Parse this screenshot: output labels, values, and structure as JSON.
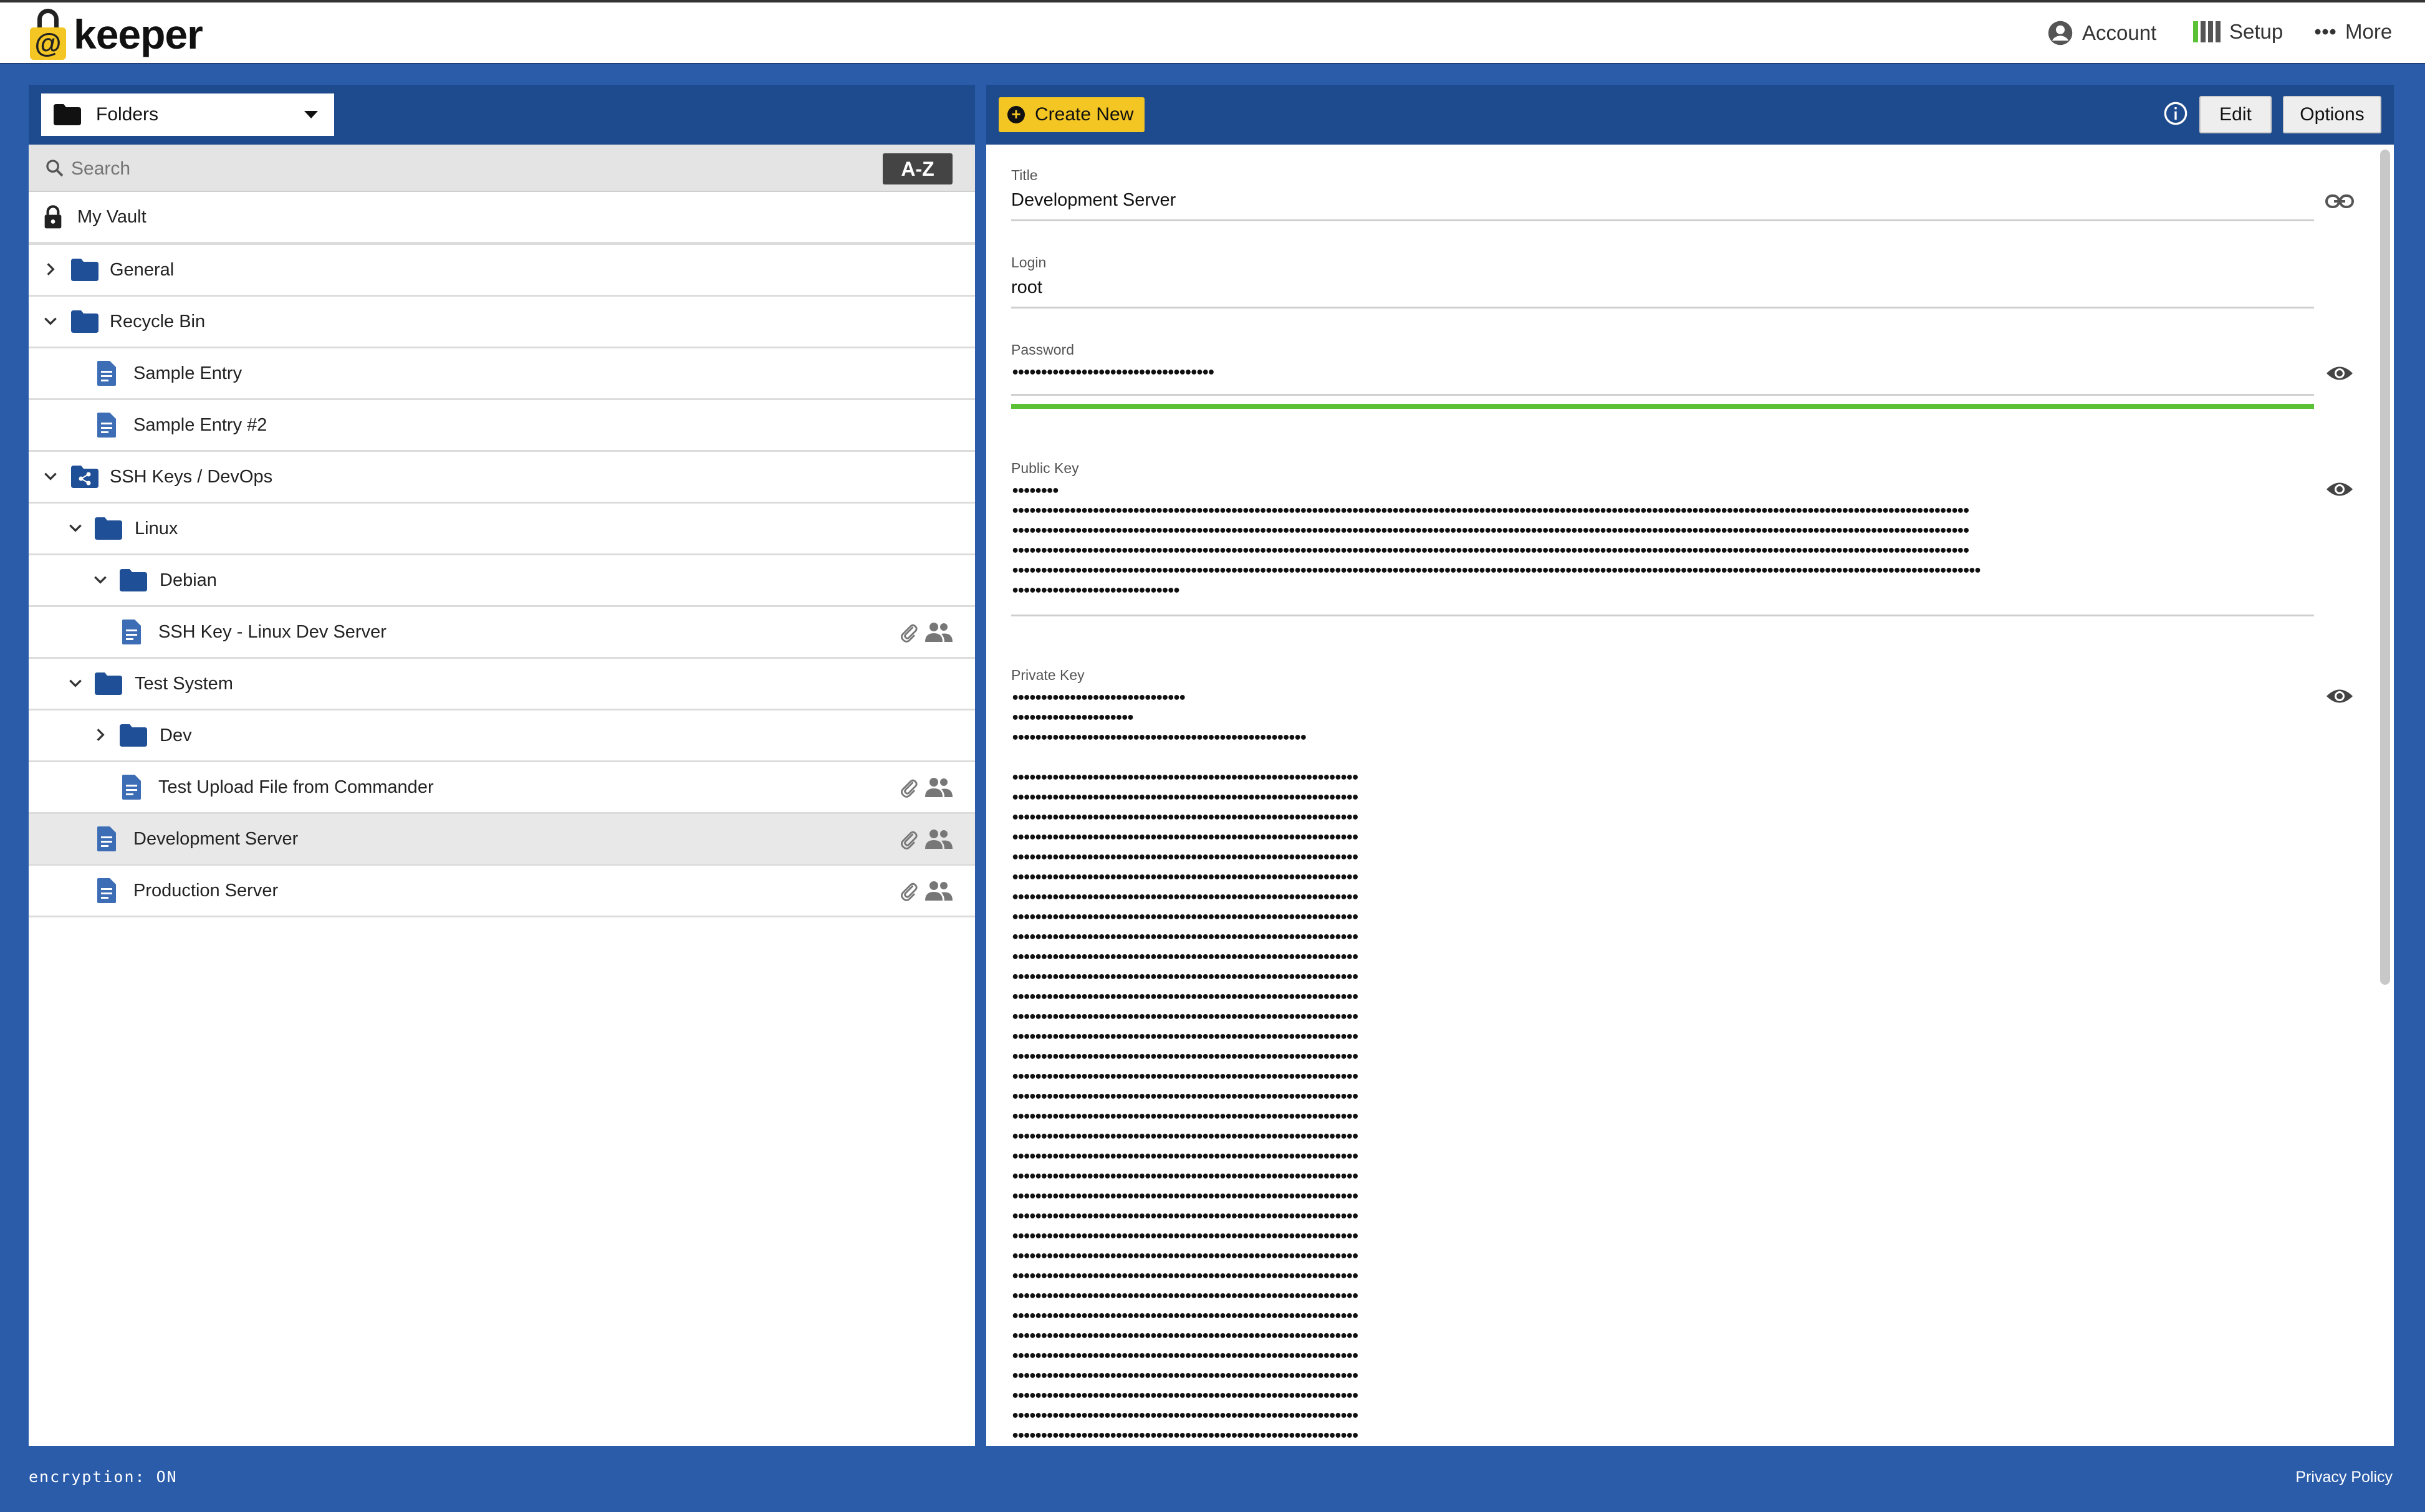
{
  "app": {
    "logo_symbol": "@",
    "logo_text": "keeper"
  },
  "topnav": {
    "account_label": "Account",
    "setup_label": "Setup",
    "more_label": "More"
  },
  "left": {
    "folders_select": "Folders",
    "search_placeholder": "Search",
    "sort_label": "A-Z",
    "tree": [
      {
        "label": "My Vault",
        "type": "vault",
        "expanded": null
      },
      {
        "label": "General",
        "type": "folder",
        "expanded": false
      },
      {
        "label": "Recycle Bin",
        "type": "folder",
        "expanded": true
      },
      {
        "label": "Sample Entry",
        "type": "record"
      },
      {
        "label": "Sample Entry #2",
        "type": "record"
      },
      {
        "label": "SSH Keys / DevOps",
        "type": "shared-folder",
        "expanded": true
      },
      {
        "label": "Linux",
        "type": "folder",
        "expanded": true
      },
      {
        "label": "Debian",
        "type": "folder",
        "expanded": true
      },
      {
        "label": "SSH Key - Linux Dev Server",
        "type": "record",
        "attachment": true,
        "shared": true
      },
      {
        "label": "Test System",
        "type": "folder",
        "expanded": true
      },
      {
        "label": "Dev",
        "type": "folder",
        "expanded": false
      },
      {
        "label": "Test Upload File from Commander",
        "type": "record",
        "attachment": true,
        "shared": true
      },
      {
        "label": "Development Server",
        "type": "record",
        "attachment": true,
        "shared": true,
        "selected": true
      },
      {
        "label": "Production Server",
        "type": "record",
        "attachment": true,
        "shared": true
      }
    ]
  },
  "right": {
    "create_new_label": "Create New",
    "edit_label": "Edit",
    "options_label": "Options",
    "fields": {
      "title_label": "Title",
      "title_value": "Development Server",
      "login_label": "Login",
      "login_value": "root",
      "password_label": "Password",
      "password_value": "•••••••••••••••••••••••••••••••••••",
      "password_strength": 1.0,
      "public_key_label": "Public Key",
      "public_key_value": "••••••••\n••••••••••••••••••••••••••••••••••••••••••••••••••••••••••••••••••••••••••••••••••••••••••••••••••••••••••••••••••••••••••••••••••••••••••••••••••••••••••••••••••••••\n••••••••••••••••••••••••••••••••••••••••••••••••••••••••••••••••••••••••••••••••••••••••••••••••••••••••••••••••••••••••••••••••••••••••••••••••••••••••••••••••••••••\n••••••••••••••••••••••••••••••••••••••••••••••••••••••••••••••••••••••••••••••••••••••••••••••••••••••••••••••••••••••••••••••••••••••••••••••••••••••••••••••••••••••\n••••••••••••••••••••••••••••••••••••••••••••••••••••••••••••••••••••••••••••••••••••••••••••••••••••••••••••••••••••••••••••••••••••••••••••••••••••••••••••••••••••••••\n•••••••••••••••••••••••••••••",
      "private_key_label": "Private Key",
      "private_key_value": "••••••••••••••••••••••••••••••\n•••••••••••••••••••••\n•••••••••••••••••••••••••••••••••••••••••••••••••••\n\n••••••••••••••••••••••••••••••••••••••••••••••••••••••••••••\n••••••••••••••••••••••••••••••••••••••••••••••••••••••••••••\n••••••••••••••••••••••••••••••••••••••••••••••••••••••••••••\n••••••••••••••••••••••••••••••••••••••••••••••••••••••••••••\n••••••••••••••••••••••••••••••••••••••••••••••••••••••••••••\n••••••••••••••••••••••••••••••••••••••••••••••••••••••••••••\n••••••••••••••••••••••••••••••••••••••••••••••••••••••••••••\n••••••••••••••••••••••••••••••••••••••••••••••••••••••••••••\n••••••••••••••••••••••••••••••••••••••••••••••••••••••••••••\n••••••••••••••••••••••••••••••••••••••••••••••••••••••••••••\n••••••••••••••••••••••••••••••••••••••••••••••••••••••••••••\n••••••••••••••••••••••••••••••••••••••••••••••••••••••••••••\n••••••••••••••••••••••••••••••••••••••••••••••••••••••••••••\n••••••••••••••••••••••••••••••••••••••••••••••••••••••••••••\n••••••••••••••••••••••••••••••••••••••••••••••••••••••••••••\n••••••••••••••••••••••••••••••••••••••••••••••••••••••••••••\n••••••••••••••••••••••••••••••••••••••••••••••••••••••••••••\n••••••••••••••••••••••••••••••••••••••••••••••••••••••••••••\n••••••••••••••••••••••••••••••••••••••••••••••••••••••••••••\n••••••••••••••••••••••••••••••••••••••••••••••••••••••••••••\n••••••••••••••••••••••••••••••••••••••••••••••••••••••••••••\n••••••••••••••••••••••••••••••••••••••••••••••••••••••••••••\n••••••••••••••••••••••••••••••••••••••••••••••••••••••••••••\n••••••••••••••••••••••••••••••••••••••••••••••••••••••••••••\n••••••••••••••••••••••••••••••••••••••••••••••••••••••••••••\n••••••••••••••••••••••••••••••••••••••••••••••••••••••••••••\n••••••••••••••••••••••••••••••••••••••••••••••••••••••••••••\n••••••••••••••••••••••••••••••••••••••••••••••••••••••••••••\n••••••••••••••••••••••••••••••••••••••••••••••••••••••••••••\n••••••••••••••••••••••••••••••••••••••••••••••••••••••••••••\n••••••••••••••••••••••••••••••••••••••••••••••••••••••••••••\n••••••••••••••••••••••••••••••••••••••••••••••••••••••••••••\n••••••••••••••••••••••••••••••••••••••••••••••••••••••••••••\n••••••••••••••••••••••••••••••••••••••••••••••••••••••••••••\n••••••••••••••••••••••••••••••••••••••••••••••••••••••••••••\n••••••••••••••••••••••••••••••••••••••••••••••••••••••••••••\n••••••••••••••••••••••••••••••••••••••••••••••••••••••••••••\n••••••••••••••••••••••••••••••••••••••••••••••••••••••••••••"
    }
  },
  "footer": {
    "encryption_status": "encryption: ON",
    "privacy_label": "Privacy Policy"
  },
  "colors": {
    "brand_yellow": "#f3c623",
    "header_blue": "#1e4a8e",
    "background_blue": "#2a5caa",
    "strength_green": "#5bc236",
    "folder_blue": "#1f4f96"
  }
}
